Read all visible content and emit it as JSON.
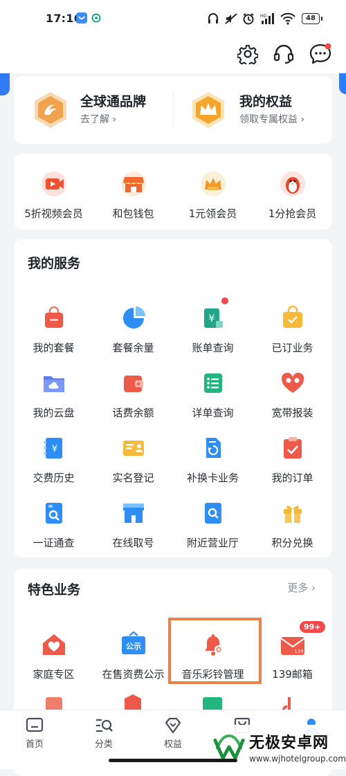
{
  "status_bar": {
    "time": "17:16",
    "battery": "48"
  },
  "header": {
    "icons": [
      "settings-icon",
      "customer-service-icon",
      "message-icon"
    ]
  },
  "promo": [
    {
      "title": "全球通品牌",
      "subtitle": "去了解 ›"
    },
    {
      "title": "我的权益",
      "subtitle": "领取专属权益 ›"
    }
  ],
  "quick_entries": [
    {
      "label": "5折视频会员",
      "icon": "video-icon"
    },
    {
      "label": "和包钱包",
      "icon": "shop-icon"
    },
    {
      "label": "1元领会员",
      "icon": "vip-crown-icon"
    },
    {
      "label": "1分抢会员",
      "icon": "penguin-icon"
    }
  ],
  "services": {
    "title": "我的服务",
    "items": [
      {
        "label": "我的套餐",
        "icon": "package-icon"
      },
      {
        "label": "套餐余量",
        "icon": "pie-chart-icon"
      },
      {
        "label": "账单查询",
        "icon": "bill-icon"
      },
      {
        "label": "已订业务",
        "icon": "subscribed-icon"
      },
      {
        "label": "我的云盘",
        "icon": "cloud-folder-icon"
      },
      {
        "label": "话费余额",
        "icon": "wallet-icon"
      },
      {
        "label": "详单查询",
        "icon": "list-icon"
      },
      {
        "label": "宽带报装",
        "icon": "broadband-heart-icon"
      },
      {
        "label": "交费历史",
        "icon": "payment-history-icon"
      },
      {
        "label": "实名登记",
        "icon": "id-card-icon"
      },
      {
        "label": "补换卡业务",
        "icon": "sim-card-icon"
      },
      {
        "label": "我的订单",
        "icon": "order-icon"
      },
      {
        "label": "一证通查",
        "icon": "id-search-icon"
      },
      {
        "label": "在线取号",
        "icon": "store-icon"
      },
      {
        "label": "附近营业厅",
        "icon": "nearby-store-icon"
      },
      {
        "label": "积分兑换",
        "icon": "gift-icon"
      }
    ]
  },
  "featured": {
    "title": "特色业务",
    "more": "更多 ›",
    "items": [
      {
        "label": "家庭专区",
        "icon": "home-heart-icon"
      },
      {
        "label": "在售资费公示",
        "icon": "notice-board-icon",
        "icon_text": "公示"
      },
      {
        "label": "音乐彩铃管理",
        "icon": "bell-gear-icon"
      },
      {
        "label": "139邮箱",
        "icon": "mail-icon",
        "icon_text": "139",
        "badge": "99+"
      }
    ]
  },
  "bottom_nav": [
    {
      "label": "首页",
      "icon": "home-tab-icon"
    },
    {
      "label": "分类",
      "icon": "category-tab-icon"
    },
    {
      "label": "权益",
      "icon": "diamond-tab-icon"
    },
    {
      "label": "",
      "icon": "bag-tab-icon"
    },
    {
      "label": "",
      "icon": "profile-tab-icon"
    }
  ],
  "watermark": {
    "title": "无极安卓网",
    "url": "www.wjhotelgroup.com"
  },
  "colors": {
    "accent_blue": "#2f7bf6",
    "highlight_orange": "#ee7f4a",
    "badge_red": "#f24a4a"
  }
}
